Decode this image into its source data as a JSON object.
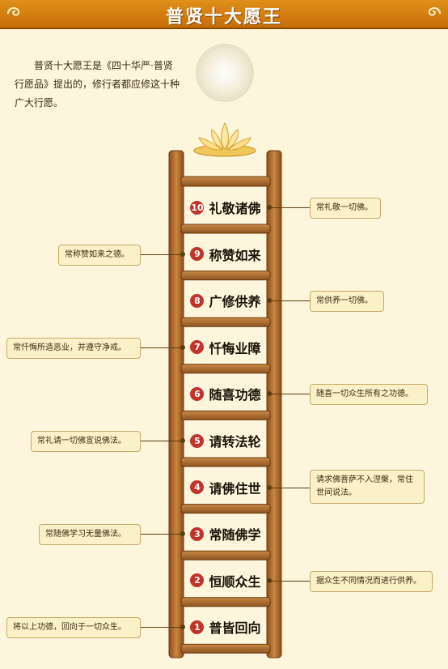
{
  "title": "普贤十大愿王",
  "intro": "普贤十大愿王是《四十华严·普贤行愿品》提出的，修行者都应修这十种广大行愿。",
  "vows": [
    {
      "num": "10",
      "name": "礼敬诸佛",
      "note": "常礼敬一切佛。"
    },
    {
      "num": "9",
      "name": "称赞如来",
      "note": "常称赞如来之德。"
    },
    {
      "num": "8",
      "name": "广修供养",
      "note": "常供养一切佛。"
    },
    {
      "num": "7",
      "name": "忏悔业障",
      "note": "常忏悔所造恶业，并遵守净戒。"
    },
    {
      "num": "6",
      "name": "随喜功德",
      "note": "随喜一切众生所有之功德。"
    },
    {
      "num": "5",
      "name": "请转法轮",
      "note": "常礼请一切佛宣说佛法。"
    },
    {
      "num": "4",
      "name": "请佛住世",
      "note": "请求佛菩萨不入涅槃，常住世间说法。"
    },
    {
      "num": "3",
      "name": "常随佛学",
      "note": "常随佛学习无量佛法。"
    },
    {
      "num": "2",
      "name": "恒顺众生",
      "note": "据众生不同情况而进行供养。"
    },
    {
      "num": "1",
      "name": "普皆回向",
      "note": "将以上功德，回向于一切众生。"
    }
  ],
  "colors": {
    "header": "#d9820f",
    "wood": "#b46f2e",
    "badge": "#c0342a",
    "note_bg": "#fbf1c9"
  }
}
